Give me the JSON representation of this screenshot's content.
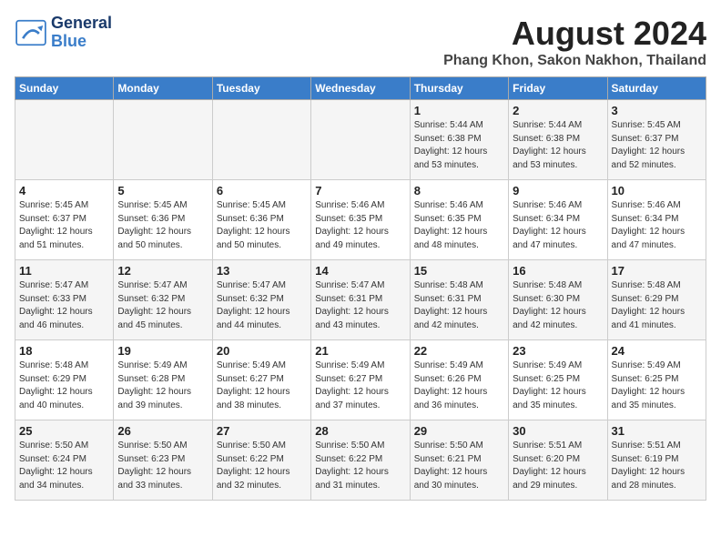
{
  "header": {
    "logo_line1": "General",
    "logo_line2": "Blue",
    "main_title": "August 2024",
    "subtitle": "Phang Khon, Sakon Nakhon, Thailand"
  },
  "days_of_week": [
    "Sunday",
    "Monday",
    "Tuesday",
    "Wednesday",
    "Thursday",
    "Friday",
    "Saturday"
  ],
  "weeks": [
    [
      {
        "day": "",
        "info": ""
      },
      {
        "day": "",
        "info": ""
      },
      {
        "day": "",
        "info": ""
      },
      {
        "day": "",
        "info": ""
      },
      {
        "day": "1",
        "info": "Sunrise: 5:44 AM\nSunset: 6:38 PM\nDaylight: 12 hours\nand 53 minutes."
      },
      {
        "day": "2",
        "info": "Sunrise: 5:44 AM\nSunset: 6:38 PM\nDaylight: 12 hours\nand 53 minutes."
      },
      {
        "day": "3",
        "info": "Sunrise: 5:45 AM\nSunset: 6:37 PM\nDaylight: 12 hours\nand 52 minutes."
      }
    ],
    [
      {
        "day": "4",
        "info": "Sunrise: 5:45 AM\nSunset: 6:37 PM\nDaylight: 12 hours\nand 51 minutes."
      },
      {
        "day": "5",
        "info": "Sunrise: 5:45 AM\nSunset: 6:36 PM\nDaylight: 12 hours\nand 50 minutes."
      },
      {
        "day": "6",
        "info": "Sunrise: 5:45 AM\nSunset: 6:36 PM\nDaylight: 12 hours\nand 50 minutes."
      },
      {
        "day": "7",
        "info": "Sunrise: 5:46 AM\nSunset: 6:35 PM\nDaylight: 12 hours\nand 49 minutes."
      },
      {
        "day": "8",
        "info": "Sunrise: 5:46 AM\nSunset: 6:35 PM\nDaylight: 12 hours\nand 48 minutes."
      },
      {
        "day": "9",
        "info": "Sunrise: 5:46 AM\nSunset: 6:34 PM\nDaylight: 12 hours\nand 47 minutes."
      },
      {
        "day": "10",
        "info": "Sunrise: 5:46 AM\nSunset: 6:34 PM\nDaylight: 12 hours\nand 47 minutes."
      }
    ],
    [
      {
        "day": "11",
        "info": "Sunrise: 5:47 AM\nSunset: 6:33 PM\nDaylight: 12 hours\nand 46 minutes."
      },
      {
        "day": "12",
        "info": "Sunrise: 5:47 AM\nSunset: 6:32 PM\nDaylight: 12 hours\nand 45 minutes."
      },
      {
        "day": "13",
        "info": "Sunrise: 5:47 AM\nSunset: 6:32 PM\nDaylight: 12 hours\nand 44 minutes."
      },
      {
        "day": "14",
        "info": "Sunrise: 5:47 AM\nSunset: 6:31 PM\nDaylight: 12 hours\nand 43 minutes."
      },
      {
        "day": "15",
        "info": "Sunrise: 5:48 AM\nSunset: 6:31 PM\nDaylight: 12 hours\nand 42 minutes."
      },
      {
        "day": "16",
        "info": "Sunrise: 5:48 AM\nSunset: 6:30 PM\nDaylight: 12 hours\nand 42 minutes."
      },
      {
        "day": "17",
        "info": "Sunrise: 5:48 AM\nSunset: 6:29 PM\nDaylight: 12 hours\nand 41 minutes."
      }
    ],
    [
      {
        "day": "18",
        "info": "Sunrise: 5:48 AM\nSunset: 6:29 PM\nDaylight: 12 hours\nand 40 minutes."
      },
      {
        "day": "19",
        "info": "Sunrise: 5:49 AM\nSunset: 6:28 PM\nDaylight: 12 hours\nand 39 minutes."
      },
      {
        "day": "20",
        "info": "Sunrise: 5:49 AM\nSunset: 6:27 PM\nDaylight: 12 hours\nand 38 minutes."
      },
      {
        "day": "21",
        "info": "Sunrise: 5:49 AM\nSunset: 6:27 PM\nDaylight: 12 hours\nand 37 minutes."
      },
      {
        "day": "22",
        "info": "Sunrise: 5:49 AM\nSunset: 6:26 PM\nDaylight: 12 hours\nand 36 minutes."
      },
      {
        "day": "23",
        "info": "Sunrise: 5:49 AM\nSunset: 6:25 PM\nDaylight: 12 hours\nand 35 minutes."
      },
      {
        "day": "24",
        "info": "Sunrise: 5:49 AM\nSunset: 6:25 PM\nDaylight: 12 hours\nand 35 minutes."
      }
    ],
    [
      {
        "day": "25",
        "info": "Sunrise: 5:50 AM\nSunset: 6:24 PM\nDaylight: 12 hours\nand 34 minutes."
      },
      {
        "day": "26",
        "info": "Sunrise: 5:50 AM\nSunset: 6:23 PM\nDaylight: 12 hours\nand 33 minutes."
      },
      {
        "day": "27",
        "info": "Sunrise: 5:50 AM\nSunset: 6:22 PM\nDaylight: 12 hours\nand 32 minutes."
      },
      {
        "day": "28",
        "info": "Sunrise: 5:50 AM\nSunset: 6:22 PM\nDaylight: 12 hours\nand 31 minutes."
      },
      {
        "day": "29",
        "info": "Sunrise: 5:50 AM\nSunset: 6:21 PM\nDaylight: 12 hours\nand 30 minutes."
      },
      {
        "day": "30",
        "info": "Sunrise: 5:51 AM\nSunset: 6:20 PM\nDaylight: 12 hours\nand 29 minutes."
      },
      {
        "day": "31",
        "info": "Sunrise: 5:51 AM\nSunset: 6:19 PM\nDaylight: 12 hours\nand 28 minutes."
      }
    ]
  ]
}
